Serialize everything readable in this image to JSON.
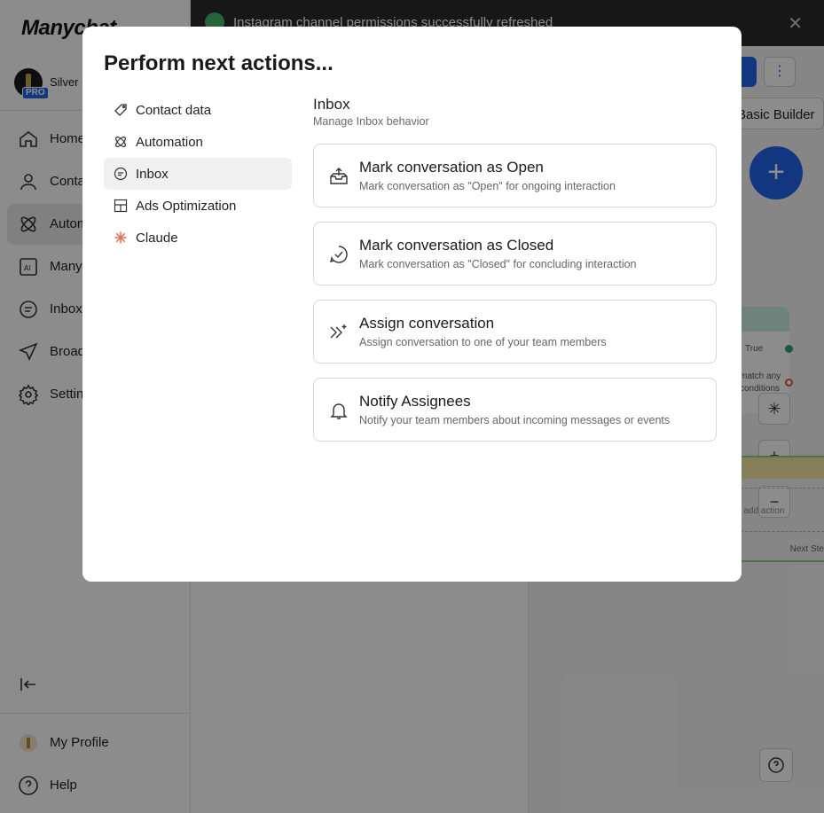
{
  "app": {
    "logo": "Manychat"
  },
  "account": {
    "name": "Silver C",
    "badge": "PRO"
  },
  "sidebar": {
    "items": [
      {
        "label": "Home",
        "icon": "home-icon"
      },
      {
        "label": "Conta",
        "icon": "user-icon"
      },
      {
        "label": "Autom",
        "icon": "automation-icon"
      },
      {
        "label": "Many",
        "icon": "ai-icon"
      },
      {
        "label": "Inbox",
        "icon": "chat-icon"
      },
      {
        "label": "Broad",
        "icon": "send-icon"
      },
      {
        "label": "Settin",
        "icon": "gear-icon"
      }
    ],
    "bottom": [
      {
        "label": "My Profile",
        "icon": "profile-icon"
      },
      {
        "label": "Help",
        "icon": "help-icon"
      }
    ]
  },
  "toast": {
    "message": "Instagram channel permissions successfully refreshed"
  },
  "toolbar": {
    "builder_label": "Basic Builder",
    "more_label": "⋮"
  },
  "canvas": {
    "node_text_1": "True",
    "node_text_2": "match any conditions",
    "node_action": "o add action",
    "next_step": "Next Ste"
  },
  "modal": {
    "title": "Perform next actions...",
    "categories": [
      {
        "label": "Contact data",
        "icon": "tag-icon"
      },
      {
        "label": "Automation",
        "icon": "automation-icon"
      },
      {
        "label": "Inbox",
        "icon": "chat-icon",
        "active": true
      },
      {
        "label": "Ads Optimization",
        "icon": "layout-icon"
      },
      {
        "label": "Claude",
        "icon": "claude-icon"
      }
    ],
    "section": {
      "title": "Inbox",
      "subtitle": "Manage Inbox behavior"
    },
    "actions": [
      {
        "title": "Mark conversation as Open",
        "description": "Mark conversation as \"Open\" for ongoing interaction",
        "icon": "open-inbox-icon"
      },
      {
        "title": "Mark conversation as Closed",
        "description": "Mark conversation as \"Closed\" for concluding interaction",
        "icon": "check-chat-icon"
      },
      {
        "title": "Assign conversation",
        "description": "Assign conversation to one of your team members",
        "icon": "assign-icon"
      },
      {
        "title": "Notify Assignees",
        "description": "Notify your team members about incoming messages or events",
        "icon": "bell-icon"
      }
    ]
  },
  "colors": {
    "accent": "#2463eb",
    "overlay": "rgba(0,0,0,0.45)",
    "success": "#46b86a"
  }
}
